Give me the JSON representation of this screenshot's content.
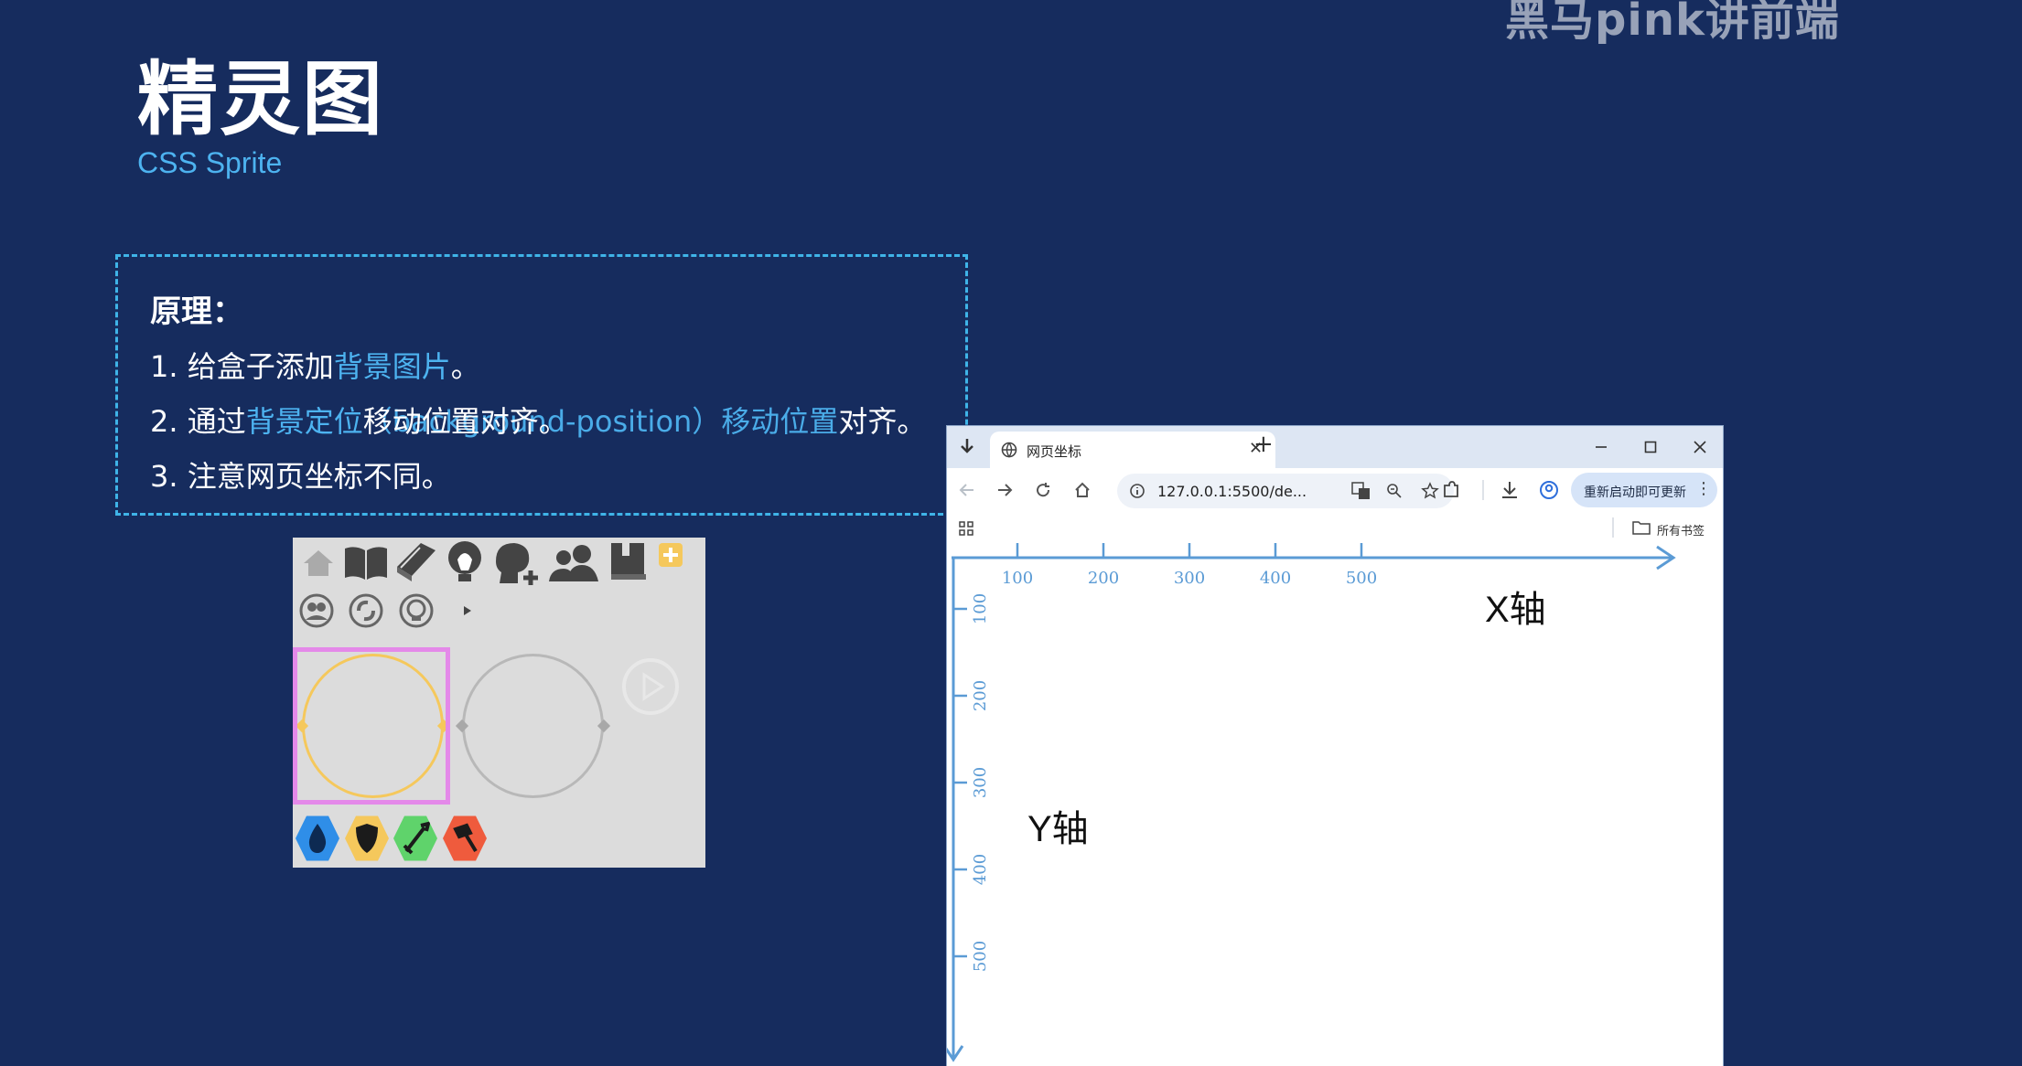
{
  "watermark": "黑马pink讲前端",
  "slide": {
    "title": "精灵图",
    "subtitle": "CSS Sprite"
  },
  "principle": {
    "heading": "原理：",
    "line1": {
      "prefix": "1. 给盒子添加",
      "highlight": "背景图片",
      "suffix": "。"
    },
    "line2": {
      "prefix": "2. 通过",
      "highlight1": "背景定位",
      "overlap_under": "（background-position）移动位置",
      "overlap_over": "移动位置对齐。",
      "suffix": "对齐。"
    },
    "line3": "3. 注意网页坐标不同。"
  },
  "sprite": {
    "icons_row1": [
      "home-icon",
      "book-open-icon",
      "book-icon",
      "lightbulb-icon",
      "add-user-head-icon",
      "users-icon",
      "save-book-icon",
      "plus-icon"
    ],
    "icons_row2": [
      "user-circle-icon",
      "refresh-circle-icon",
      "skull-circle-icon",
      "small-arrow-icon"
    ],
    "hexagons": [
      {
        "name": "water-hex-icon",
        "color": "#2f8ee8"
      },
      {
        "name": "shield-hex-icon",
        "color": "#f5c85c"
      },
      {
        "name": "sword-hex-icon",
        "color": "#5fd36b"
      },
      {
        "name": "hammer-hex-icon",
        "color": "#ef5b3d"
      }
    ],
    "frame_color": "#e489e9"
  },
  "browser": {
    "tab_title": "网页坐标",
    "address": "127.0.0.1:5500/de...",
    "update_button": "重新启动即可更新",
    "bookmarks_label": "所有书签",
    "new_tab_symbol": "+",
    "close_tab_symbol": "✕"
  },
  "coordinates": {
    "x_title": "X轴",
    "y_title": "Y轴",
    "x_ticks": [
      "100",
      "200",
      "300",
      "400",
      "500"
    ],
    "y_ticks": [
      "100",
      "200",
      "300",
      "400",
      "500"
    ],
    "axis_color": "#5b9bd5"
  }
}
